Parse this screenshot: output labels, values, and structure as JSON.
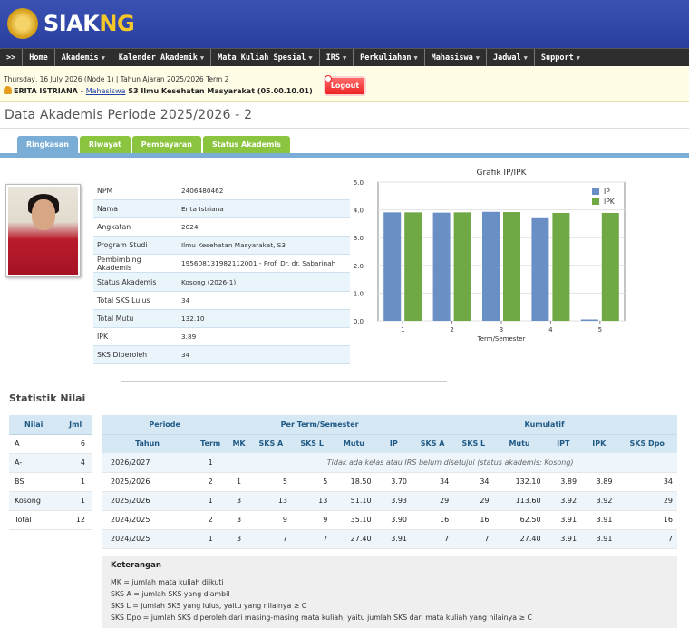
{
  "header": {
    "logo_siak": "SIAK",
    "logo_ng": "NG"
  },
  "nav": {
    "toggle": ">>",
    "items": [
      {
        "label": "Home",
        "dropdown": false
      },
      {
        "label": "Akademis",
        "dropdown": true
      },
      {
        "label": "Kalender Akademik",
        "dropdown": true
      },
      {
        "label": "Mata Kuliah Spesial",
        "dropdown": true
      },
      {
        "label": "IRS",
        "dropdown": true
      },
      {
        "label": "Perkuliahan",
        "dropdown": true
      },
      {
        "label": "Mahasiswa",
        "dropdown": true
      },
      {
        "label": "Jadwal",
        "dropdown": true
      },
      {
        "label": "Support",
        "dropdown": true
      }
    ]
  },
  "info": {
    "date_line": "Thursday, 16 July 2026 (Node 1) | Tahun Ajaran 2025/2026 Term 2",
    "user_name": "ERITA ISTRIANA",
    "sep": " - ",
    "role": "Mahasiswa",
    "program": " S3 Ilmu Kesehatan Masyarakat (05.00.10.01)",
    "logout": "Logout"
  },
  "page_title": "Data Akademis Periode 2025/2026 - 2",
  "tabs": [
    "Ringkasan",
    "Riwayat",
    "Pembayaran",
    "Status Akademis"
  ],
  "profile": [
    {
      "label": "NPM",
      "value": "2406480462"
    },
    {
      "label": "Nama",
      "value": "Erita Istriana"
    },
    {
      "label": "Angkatan",
      "value": "2024"
    },
    {
      "label": "Program Studi",
      "value": "Ilmu Kesehatan Masyarakat, S3"
    },
    {
      "label": "Pembimbing Akademis",
      "value": "195608131982112001 - Prof. Dr. dr. Sabarinah"
    },
    {
      "label": "Status Akademis",
      "value": "Kosong (2026-1)"
    },
    {
      "label": "Total SKS Lulus",
      "value": "34"
    },
    {
      "label": "Total Mutu",
      "value": "132.10"
    },
    {
      "label": "IPK",
      "value": "3.89"
    },
    {
      "label": "SKS Diperoleh",
      "value": "34"
    }
  ],
  "chart_data": {
    "type": "bar",
    "title": "Grafik IP/IPK",
    "xlabel": "Term/Semester",
    "ylabel": "",
    "categories": [
      "1",
      "2",
      "3",
      "4",
      "5"
    ],
    "series": [
      {
        "name": "IP",
        "color": "#6a8fc4",
        "values": [
          3.91,
          3.9,
          3.93,
          3.7,
          0
        ]
      },
      {
        "name": "IPK",
        "color": "#6fa844",
        "values": [
          3.91,
          3.91,
          3.92,
          3.89,
          3.89
        ]
      }
    ],
    "ylim": [
      0,
      5
    ],
    "yticks": [
      "0.0",
      "1.0",
      "2.0",
      "3.0",
      "4.0",
      "5.0"
    ],
    "legend": "top-right",
    "grid": true
  },
  "statistik": {
    "title": "Statistik Nilai",
    "headers": [
      "Nilai",
      "Jml"
    ],
    "rows": [
      [
        "A",
        "6"
      ],
      [
        "A-",
        "4"
      ],
      [
        "BS",
        "1"
      ],
      [
        "Kosong",
        "1"
      ],
      [
        "Total",
        "12"
      ]
    ]
  },
  "periode": {
    "group_headers": [
      "Periode",
      "Per Term/Semester",
      "Kumulatif"
    ],
    "headers": [
      "Tahun",
      "Term",
      "MK",
      "SKS A",
      "SKS L",
      "Mutu",
      "IP",
      "SKS A",
      "SKS L",
      "Mutu",
      "IPT",
      "IPK",
      "SKS Dpo"
    ],
    "note_row": {
      "tahun": "2026/2027",
      "term": "1",
      "note": "Tidak ada kelas atau IRS belum disetujui (status akademis: Kosong)"
    },
    "rows": [
      [
        "2025/2026",
        "2",
        "1",
        "5",
        "5",
        "18.50",
        "3.70",
        "34",
        "34",
        "132.10",
        "3.89",
        "3.89",
        "34"
      ],
      [
        "2025/2026",
        "1",
        "3",
        "13",
        "13",
        "51.10",
        "3.93",
        "29",
        "29",
        "113.60",
        "3.92",
        "3.92",
        "29"
      ],
      [
        "2024/2025",
        "2",
        "3",
        "9",
        "9",
        "35.10",
        "3.90",
        "16",
        "16",
        "62.50",
        "3.91",
        "3.91",
        "16"
      ],
      [
        "2024/2025",
        "1",
        "3",
        "7",
        "7",
        "27.40",
        "3.91",
        "7",
        "7",
        "27.40",
        "3.91",
        "3.91",
        "7"
      ]
    ]
  },
  "keterangan": {
    "title": "Keterangan",
    "lines": [
      "MK = jumlah mata kuliah diikuti",
      "SKS A = jumlah SKS yang diambil",
      "SKS L = jumlah SKS yang lulus, yaitu yang nilainya ≥ C",
      "SKS Dpo = jumlah SKS diperoleh dari masing-masing mata kuliah, yaitu jumlah SKS dari mata kuliah yang nilainya ≥ C"
    ]
  }
}
